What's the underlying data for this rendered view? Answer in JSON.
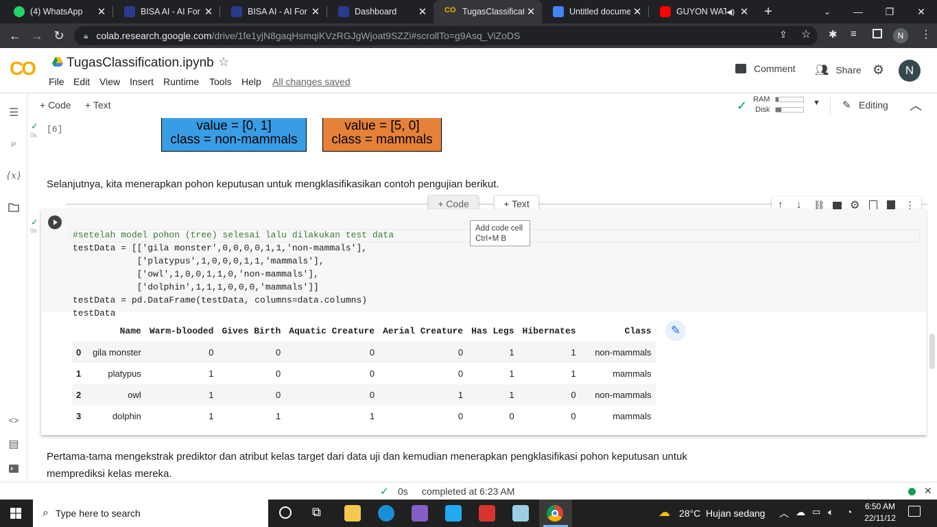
{
  "browser": {
    "tabs": [
      {
        "title": "(4) WhatsApp",
        "color": "#25d366"
      },
      {
        "title": "BISA AI - AI For Education",
        "color": "#2a3b8f"
      },
      {
        "title": "BISA AI - AI For Education",
        "color": "#2a3b8f"
      },
      {
        "title": "Dashboard",
        "color": "#2a3b8f"
      },
      {
        "title": "TugasClassification.ipynb",
        "color": "#f9ab00"
      },
      {
        "title": "Untitled document",
        "color": "#4285f4"
      },
      {
        "title": "GUYON WATON",
        "color": "#ff0000"
      }
    ],
    "url_host": "colab.research.google.com",
    "url_path": "/drive/1fe1yjN8gaqHsmqiKVzRGJgWjoat9SZZi#scrollTo=g9Asq_ViZoDS",
    "profile_initial": "N"
  },
  "colab": {
    "logo": "CO",
    "filename": "TugasClassification.ipynb",
    "menu": [
      "File",
      "Edit",
      "View",
      "Insert",
      "Runtime",
      "Tools",
      "Help"
    ],
    "saved_status": "All changes saved",
    "comment_label": "Comment",
    "share_label": "Share",
    "avatar_initial": "N",
    "add_code": "+ Code",
    "add_text": "+ Text",
    "ram_label": "RAM",
    "disk_label": "Disk",
    "editing_label": "Editing"
  },
  "cells": {
    "prev_exec": "[6]",
    "prev_time": "0s",
    "node_left_lines": [
      "value = [0, 1]",
      "class = non-mammals"
    ],
    "node_right_lines": [
      "value = [5, 0]",
      "class = mammals"
    ],
    "node_left_color": "#399de5",
    "node_right_color": "#e58139",
    "markdown_1": "Selanjutnya, kita menerapkan pohon keputusan untuk mengklasifikasikan contoh pengujian berikut.",
    "insert_code": "Code",
    "insert_text": "Text",
    "tooltip_line1": "Add code cell",
    "tooltip_line2": "Ctrl+M B",
    "cell_time": "0s",
    "code_lines": [
      "#setelah model pohon (tree) selesai lalu dilakukan test data",
      "testData = [['gila monster',0,0,0,0,1,1,'non-mammals'],",
      "            ['platypus',1,0,0,0,1,1,'mammals'],",
      "            ['owl',1,0,0,1,1,0,'non-mammals'],",
      "            ['dolphin',1,1,1,0,0,0,'mammals']]",
      "testData = pd.DataFrame(testData, columns=data.columns)",
      "testData"
    ],
    "table": {
      "columns": [
        "",
        "Name",
        "Warm-blooded",
        "Gives Birth",
        "Aquatic Creature",
        "Aerial Creature",
        "Has Legs",
        "Hibernates",
        "Class"
      ],
      "rows": [
        [
          "0",
          "gila monster",
          "0",
          "0",
          "0",
          "0",
          "1",
          "1",
          "non-mammals"
        ],
        [
          "1",
          "platypus",
          "1",
          "0",
          "0",
          "0",
          "1",
          "1",
          "mammals"
        ],
        [
          "2",
          "owl",
          "1",
          "0",
          "0",
          "1",
          "1",
          "0",
          "non-mammals"
        ],
        [
          "3",
          "dolphin",
          "1",
          "1",
          "1",
          "0",
          "0",
          "0",
          "mammals"
        ]
      ]
    },
    "markdown_2_line1": "Pertama-tama mengekstrak prediktor dan atribut kelas target dari data uji dan kemudian menerapkan pengklasifikasi pohon keputusan untuk",
    "markdown_2_line2": "memprediksi kelas mereka."
  },
  "status": {
    "check": "✓",
    "time": "0s",
    "completed": "completed at 6:23 AM"
  },
  "taskbar": {
    "search_placeholder": "Type here to search",
    "weather": "28°C  Hujan sedang",
    "clock_time": "6:50 AM",
    "clock_date": "22/11/12"
  }
}
